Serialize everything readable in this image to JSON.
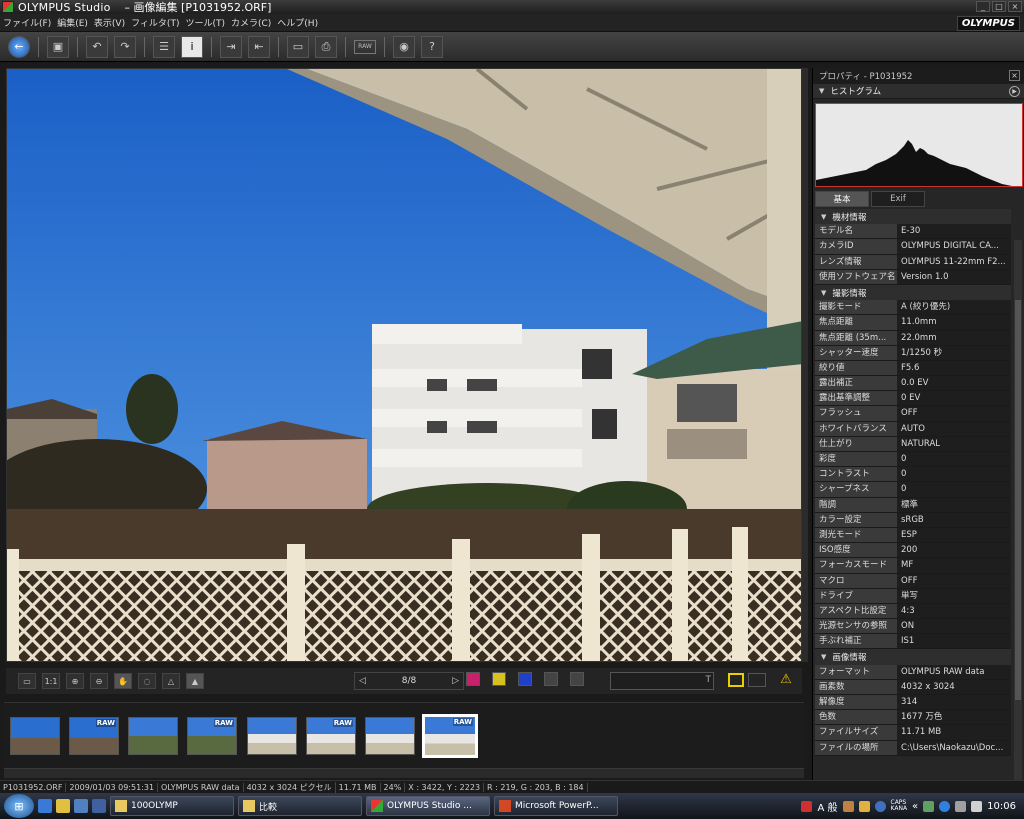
{
  "window": {
    "title": "OLYMPUS Studio",
    "subtitle": "– 画像編集 [P1031952.ORF]",
    "brand": "OLYMPUS"
  },
  "menu": [
    "ファイル(F)",
    "編集(E)",
    "表示(V)",
    "フィルタ(T)",
    "ツール(T)",
    "カメラ(C)",
    "ヘルプ(H)"
  ],
  "toolbar": {
    "raw_label": "RAW",
    "help_label": "?"
  },
  "viewer": {
    "nav_count": "8/8",
    "text_tool": "T"
  },
  "thumbnails": [
    {
      "raw": ""
    },
    {
      "raw": "RAW"
    },
    {
      "raw": ""
    },
    {
      "raw": "RAW"
    },
    {
      "raw": ""
    },
    {
      "raw": "RAW"
    },
    {
      "raw": ""
    },
    {
      "raw": "RAW"
    }
  ],
  "props": {
    "title": "プロパティ - P1031952",
    "histogram_label": "ヒストグラム",
    "tab_basic": "基本",
    "tab_exif": "Exif",
    "sections": [
      {
        "name": "機材情報",
        "rows": [
          {
            "k": "モデル名",
            "v": "E-30"
          },
          {
            "k": "カメラID",
            "v": "OLYMPUS DIGITAL CA..."
          },
          {
            "k": "レンズ情報",
            "v": "OLYMPUS 11-22mm F2..."
          },
          {
            "k": "使用ソフトウェア名",
            "v": "Version 1.0"
          }
        ]
      },
      {
        "name": "撮影情報",
        "rows": [
          {
            "k": "撮影モード",
            "v": "A (絞り優先)"
          },
          {
            "k": "焦点距離",
            "v": "11.0mm"
          },
          {
            "k": "焦点距離 (35m...",
            "v": "22.0mm"
          },
          {
            "k": "シャッター速度",
            "v": "1/1250 秒"
          },
          {
            "k": "絞り値",
            "v": "F5.6"
          },
          {
            "k": "露出補正",
            "v": "0.0 EV"
          },
          {
            "k": "露出基準調整",
            "v": "0 EV"
          },
          {
            "k": "フラッシュ",
            "v": "OFF"
          },
          {
            "k": "ホワイトバランス",
            "v": "AUTO"
          },
          {
            "k": "仕上がり",
            "v": "NATURAL"
          },
          {
            "k": "彩度",
            "v": "0"
          },
          {
            "k": "コントラスト",
            "v": "0"
          },
          {
            "k": "シャープネス",
            "v": "0"
          },
          {
            "k": "階調",
            "v": "標準"
          },
          {
            "k": "カラー設定",
            "v": "sRGB"
          },
          {
            "k": "測光モード",
            "v": "ESP"
          },
          {
            "k": "ISO感度",
            "v": "200"
          },
          {
            "k": "フォーカスモード",
            "v": "MF"
          },
          {
            "k": "マクロ",
            "v": "OFF"
          },
          {
            "k": "ドライブ",
            "v": "単写"
          },
          {
            "k": "アスペクト比設定",
            "v": "4:3"
          },
          {
            "k": "光源センサの参照",
            "v": "ON"
          },
          {
            "k": "手ぶれ補正",
            "v": "IS1"
          }
        ]
      },
      {
        "name": "画像情報",
        "rows": [
          {
            "k": "フォーマット",
            "v": "OLYMPUS RAW data"
          },
          {
            "k": "画素数",
            "v": "4032 x 3024"
          },
          {
            "k": "解像度",
            "v": "314"
          },
          {
            "k": "色数",
            "v": "1677 万色"
          },
          {
            "k": "ファイルサイズ",
            "v": "11.71 MB"
          },
          {
            "k": "ファイルの場所",
            "v": "C:\\Users\\Naokazu\\Doc..."
          }
        ]
      }
    ]
  },
  "status": {
    "filename": "P1031952.ORF",
    "datetime": "2009/01/03 09:51:31",
    "format": "OLYMPUS RAW data",
    "dims": "4032 x 3024 ピクセル",
    "size": "11.71 MB",
    "zoom": "24%",
    "coords": "X : 3422, Y : 2223",
    "rgb": "R : 219, G : 203, B : 184"
  },
  "taskbar": {
    "tasks": [
      "100OLYMP",
      "比較",
      "OLYMPUS Studio ...",
      "Microsoft PowerP..."
    ],
    "ime": "A 般",
    "clock": "10:06",
    "caps": "CAPS",
    "kana": "KANA"
  }
}
